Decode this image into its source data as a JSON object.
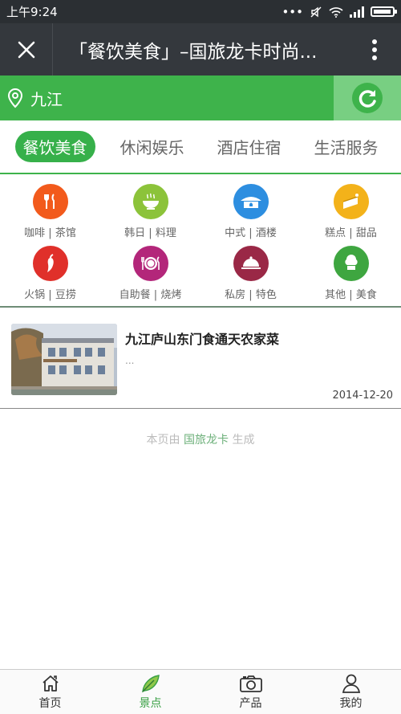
{
  "status": {
    "time": "上午9:24"
  },
  "titlebar": {
    "title": "「餐饮美食」–国旅龙卡时尚..."
  },
  "location": {
    "city": "九江"
  },
  "tabs": [
    {
      "label": "餐饮美食"
    },
    {
      "label": "休闲娱乐"
    },
    {
      "label": "酒店住宿"
    },
    {
      "label": "生活服务"
    }
  ],
  "categories": [
    {
      "label": "咖啡 | 茶馆",
      "icon": "fork-knife-icon",
      "color": "#f25a1c"
    },
    {
      "label": "韩日 | 料理",
      "icon": "hotpot-icon",
      "color": "#8cc33a"
    },
    {
      "label": "中式 | 酒楼",
      "icon": "chinese-restaurant-icon",
      "color": "#2d8ee0"
    },
    {
      "label": "糕点 | 甜品",
      "icon": "cake-icon",
      "color": "#f3b21a"
    },
    {
      "label": "火锅 | 豆捞",
      "icon": "chili-icon",
      "color": "#e0302a"
    },
    {
      "label": "自助餐 | 烧烤",
      "icon": "plate-icon",
      "color": "#b3267a"
    },
    {
      "label": "私房 | 特色",
      "icon": "cloche-icon",
      "color": "#9a2846"
    },
    {
      "label": "其他 | 美食",
      "icon": "chef-hat-icon",
      "color": "#3ea640"
    }
  ],
  "list": [
    {
      "title": "九江庐山东门食通天农家菜",
      "desc": "...",
      "date": "2014-12-20"
    }
  ],
  "footer": {
    "prefix": "本页由",
    "brand": "国旅龙卡",
    "suffix": "生成"
  },
  "bottom_nav": [
    {
      "label": "首页",
      "icon": "home-icon"
    },
    {
      "label": "景点",
      "icon": "leaf-icon"
    },
    {
      "label": "产品",
      "icon": "camera-icon"
    },
    {
      "label": "我的",
      "icon": "person-icon"
    }
  ],
  "colors": {
    "accent": "#3eb34b",
    "titlebar": "#34383d"
  }
}
